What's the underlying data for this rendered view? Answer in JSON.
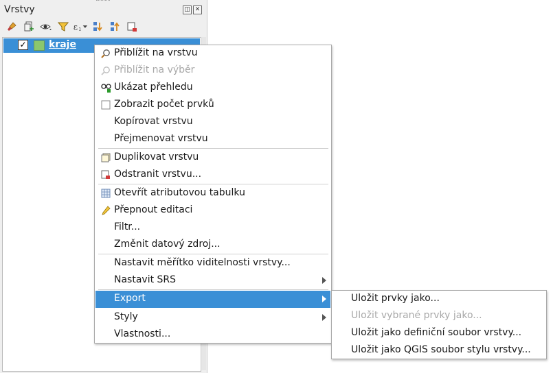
{
  "panel": {
    "title": "Vrstvy",
    "float_glyph": "◫",
    "close_glyph": "✕",
    "toolbar_icons": [
      "style-brush-icon",
      "add-group-icon",
      "visibility-eye-icon",
      "filter-icon",
      "expression-filter-icon",
      "expand-all-icon",
      "collapse-all-icon",
      "remove-layer-icon"
    ]
  },
  "tree": {
    "layer": {
      "label": "kraje",
      "checked": "✓",
      "swatch_color": "#8bc76d"
    }
  },
  "context_menu": {
    "items": [
      {
        "label": "Přiblížit na vrstvu",
        "icon": "zoom-layer-icon"
      },
      {
        "label": "Přiblížit na výběr",
        "icon": "zoom-selection-icon"
      },
      {
        "label": "Ukázat přehledu",
        "icon": "overview-icon"
      },
      {
        "label": "Zobrazit počet prvků",
        "icon": "checkbox-icon"
      },
      {
        "label": "Kopírovat vrstvu"
      },
      {
        "label": "Přejmenovat vrstvu"
      },
      {
        "label": "Duplikovat vrstvu",
        "icon": "duplicate-layer-icon"
      },
      {
        "label": "Odstranit vrstvu...",
        "icon": "remove-layer-icon"
      },
      {
        "label": "Otevřít atributovou tabulku",
        "icon": "attribute-table-icon"
      },
      {
        "label": "Přepnout editaci",
        "icon": "pencil-icon"
      },
      {
        "label": "Filtr..."
      },
      {
        "label": "Změnit datový zdroj..."
      },
      {
        "label": "Nastavit měřítko viditelnosti vrstvy..."
      },
      {
        "label": "Nastavit SRS"
      },
      {
        "label": "Export"
      },
      {
        "label": "Styly"
      },
      {
        "label": "Vlastnosti..."
      }
    ]
  },
  "export_submenu": {
    "items": [
      {
        "label": "Uložit prvky jako..."
      },
      {
        "label": "Uložit vybrané prvky jako..."
      },
      {
        "label": "Uložit jako definiční soubor vrstvy..."
      },
      {
        "label": "Uložit jako QGIS soubor stylu vrstvy..."
      }
    ]
  },
  "colors": {
    "accent": "#3a8fd6",
    "disabled_text": "#a8a8a8"
  }
}
